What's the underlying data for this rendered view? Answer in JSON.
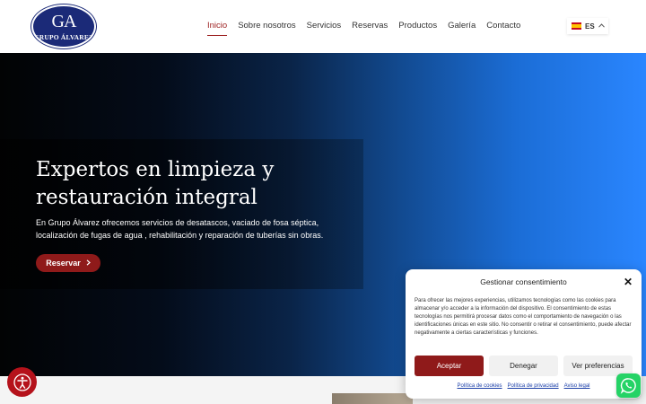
{
  "header": {
    "logo": {
      "monogram": "GA",
      "brand": "GRUPO ÁLVAREZ"
    },
    "nav": [
      {
        "label": "Inicio",
        "active": true
      },
      {
        "label": "Sobre nosotros",
        "active": false
      },
      {
        "label": "Servicios",
        "active": false
      },
      {
        "label": "Reservas",
        "active": false
      },
      {
        "label": "Productos",
        "active": false
      },
      {
        "label": "Galería",
        "active": false
      },
      {
        "label": "Contacto",
        "active": false
      }
    ],
    "language": {
      "code": "ES",
      "flag_icon": "spain-flag-icon",
      "chevron_icon": "chevron-up-icon"
    }
  },
  "hero": {
    "title": "Expertos en limpieza y restauración integral",
    "text": "En Grupo Álvarez ofrecemos servicios de desatascos, vaciado de fosa séptica, localización de fugas de agua , rehabilitación y reparación de tuberías sin obras.",
    "button_label": "Reservar",
    "button_icon": "chevron-right-icon"
  },
  "consent": {
    "title": "Gestionar consentimiento",
    "body": "Para ofrecer las mejores experiencias, utilizamos tecnologías como las cookies para almacenar y/o acceder a la información del dispositivo. El consentimiento de estas tecnologías nos permitirá procesar datos como el comportamiento de navegación o las identificaciones únicas en este sitio. No consentir o retirar el consentimiento, puede afectar negativamente a ciertas características y funciones.",
    "accept_label": "Aceptar",
    "deny_label": "Denegar",
    "prefs_label": "Ver preferencias",
    "links": [
      "Política de cookies",
      "Política de privacidad",
      "Aviso legal"
    ]
  },
  "icons": {
    "accessibility": "accessibility-icon",
    "whatsapp": "whatsapp-icon",
    "close": "close-icon"
  },
  "colors": {
    "brand_navy": "#1b2a78",
    "accent_red": "#8f1a1a",
    "whatsapp_green": "#25d366"
  }
}
